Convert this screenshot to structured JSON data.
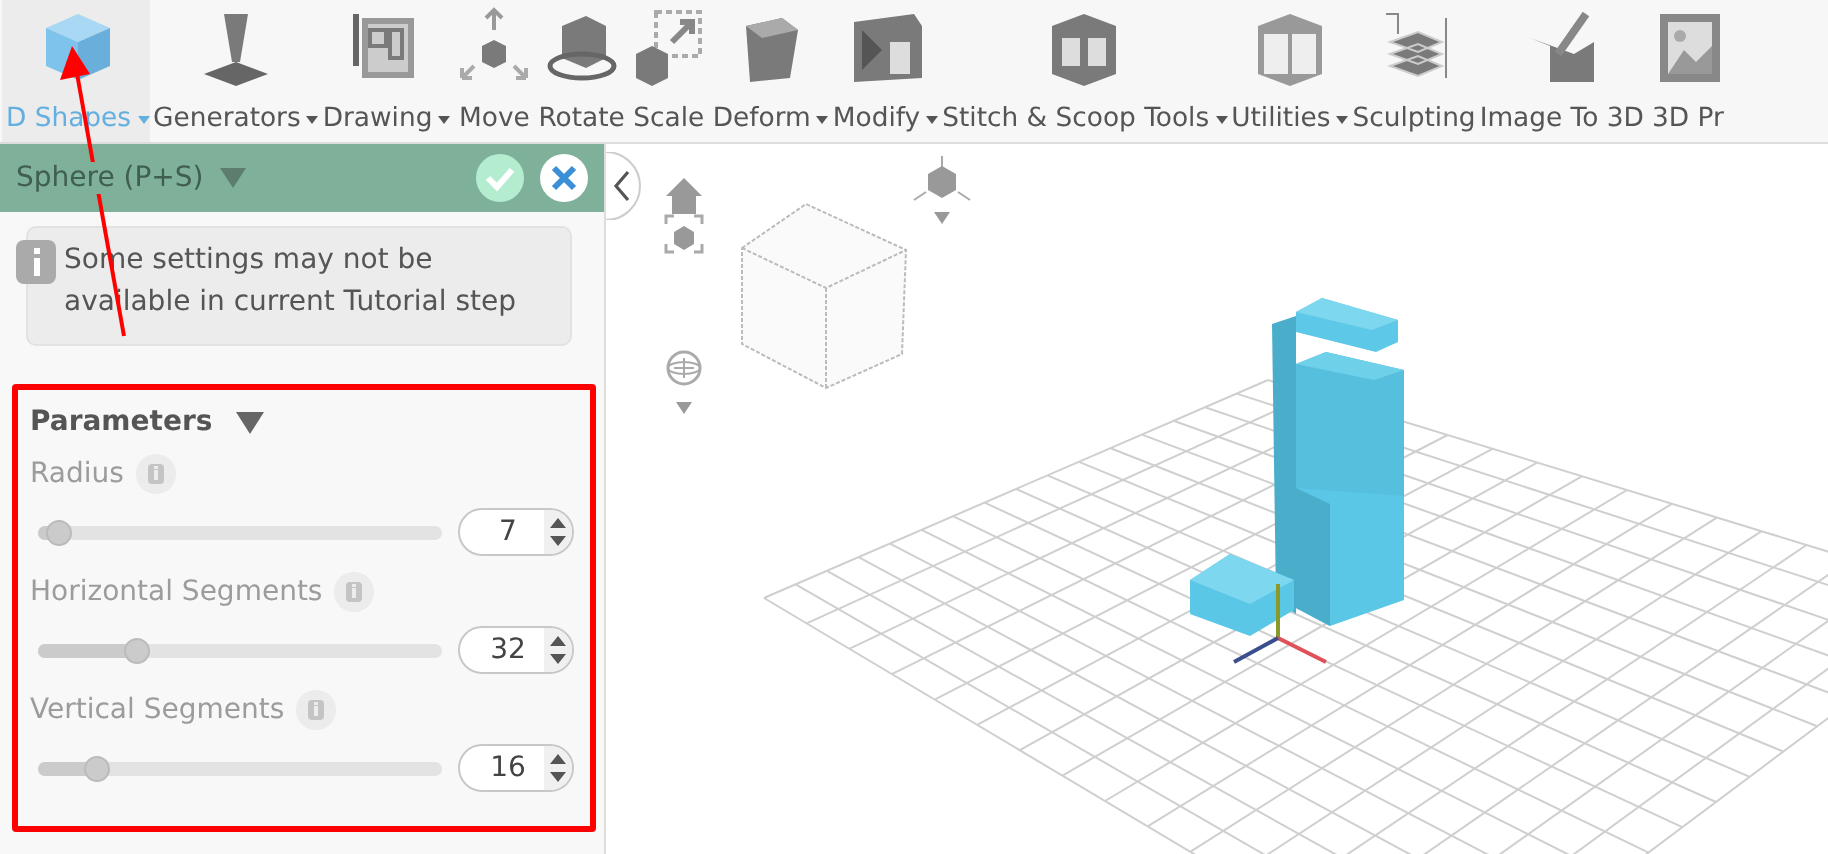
{
  "toolbar": {
    "items": [
      {
        "label": "D Shapes",
        "dropdown": true,
        "selected": true
      },
      {
        "label": "Generators",
        "dropdown": true,
        "selected": false
      },
      {
        "label": "Drawing",
        "dropdown": true,
        "selected": false
      },
      {
        "label": "Move",
        "dropdown": false,
        "selected": false
      },
      {
        "label": "Rotate",
        "dropdown": false,
        "selected": false
      },
      {
        "label": "Scale",
        "dropdown": false,
        "selected": false
      },
      {
        "label": "Deform",
        "dropdown": true,
        "selected": false
      },
      {
        "label": "Modify",
        "dropdown": true,
        "selected": false
      },
      {
        "label": "Stitch & Scoop Tools",
        "dropdown": true,
        "selected": false
      },
      {
        "label": "Utilities",
        "dropdown": true,
        "selected": false
      },
      {
        "label": "Sculpting",
        "dropdown": false,
        "selected": false
      },
      {
        "label": "Image To 3D",
        "dropdown": false,
        "selected": false
      },
      {
        "label": "3D Pr",
        "dropdown": false,
        "selected": false
      }
    ]
  },
  "panel": {
    "title": "Sphere (P+S)",
    "notice": "Some settings may not be available in current Tutorial step",
    "section": {
      "title": "Parameters",
      "expanded": true
    },
    "params": [
      {
        "label": "Radius",
        "level": 0.02,
        "value": "7"
      },
      {
        "label": "Horizontal Segments",
        "level": 0.23,
        "value": "32"
      },
      {
        "label": "Vertical Segments",
        "level": 0.12,
        "value": "16"
      }
    ]
  }
}
